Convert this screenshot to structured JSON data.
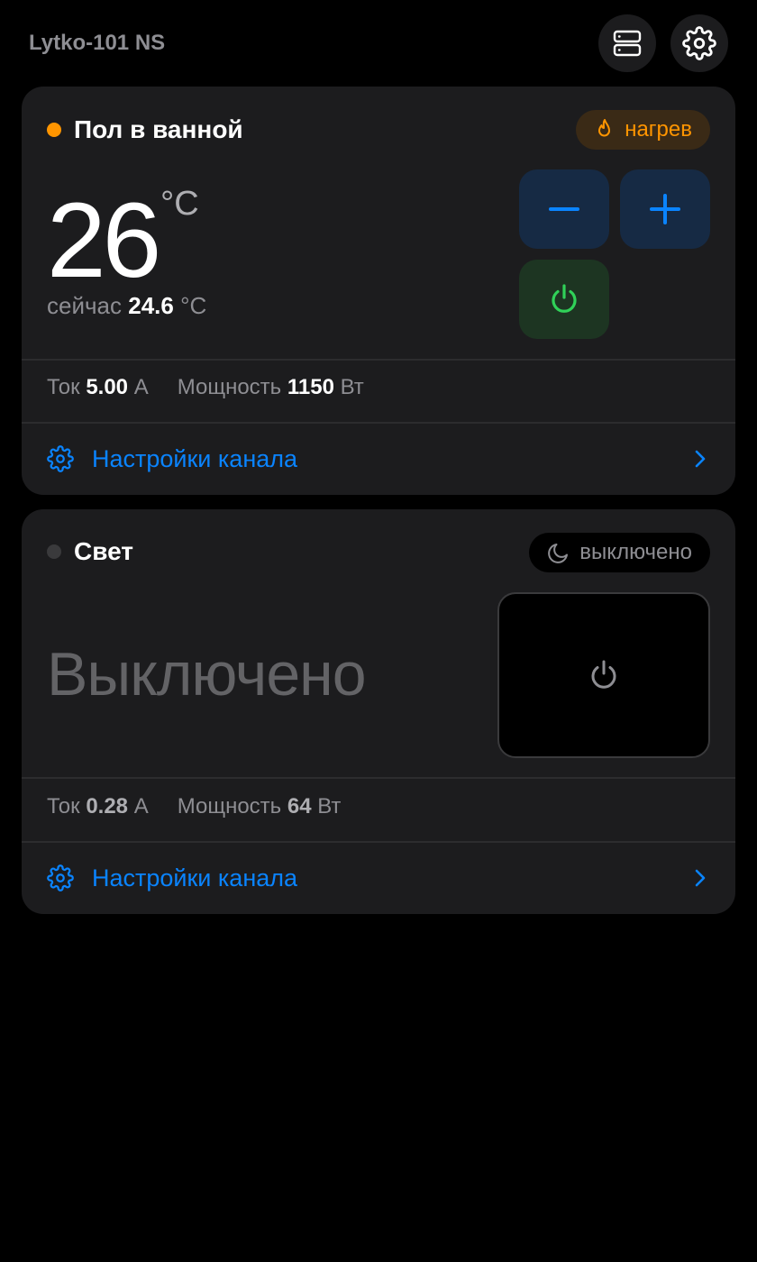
{
  "header": {
    "device_name": "Lytko-101 NS",
    "buttons": [
      {
        "icon": "server-icon"
      },
      {
        "icon": "gear-icon"
      }
    ]
  },
  "channels": [
    {
      "title": "Пол в ванной",
      "status_color": "#ff9500",
      "status": {
        "label": "нагрев",
        "icon": "flame-icon",
        "color": "#ff9500"
      },
      "target_temp": "26",
      "temp_unit": "°C",
      "now_label": "сейчас",
      "now_value": "24.6",
      "now_unit": "°C",
      "controls": {
        "minus_icon": "minus-icon",
        "plus_icon": "plus-icon",
        "power_icon": "power-icon",
        "power_color": "#30d158"
      },
      "stats": {
        "current_label": "Ток",
        "current_value": "5.00",
        "current_unit": "А",
        "power_label": "Мощность",
        "power_value": "1150",
        "power_unit": "Вт"
      },
      "settings_label": "Настройки канала"
    },
    {
      "title": "Свет",
      "status_color": "#3a3a3c",
      "status": {
        "label": "выключено",
        "icon": "moon-icon",
        "color": "#8e8e93"
      },
      "state_text": "Выключено",
      "controls": {
        "power_icon": "power-icon"
      },
      "stats": {
        "current_label": "Ток",
        "current_value": "0.28",
        "current_unit": "А",
        "power_label": "Мощность",
        "power_value": "64",
        "power_unit": "Вт"
      },
      "settings_label": "Настройки канала"
    }
  ],
  "colors": {
    "accent": "#0a84ff",
    "heating": "#ff9500",
    "power_on": "#30d158",
    "card_bg": "#1c1c1e"
  }
}
